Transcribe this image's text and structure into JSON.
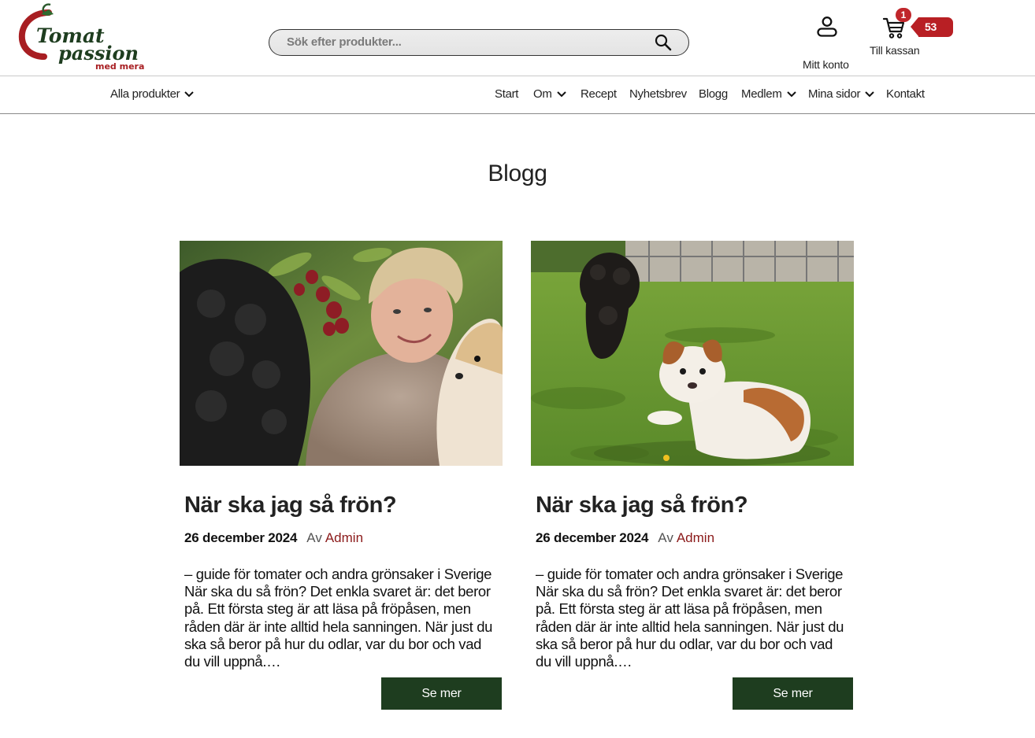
{
  "header": {
    "logo": {
      "line1": "Tomat",
      "line2": "passion",
      "tagline": "med mera"
    },
    "search": {
      "placeholder": "Sök efter produkter..."
    },
    "account_label": "Mitt konto",
    "cart": {
      "label": "Till kassan",
      "count": "1",
      "amount": "53 kr"
    }
  },
  "nav": {
    "all_products": "Alla produkter",
    "items": [
      "Start",
      "Om",
      "Recept",
      "Nyhetsbrev",
      "Blogg",
      "Medlem",
      "Mina sidor",
      "Kontakt"
    ]
  },
  "page": {
    "title": "Blogg"
  },
  "posts": [
    {
      "title": "När ska jag så frön?",
      "date": "26 december 2024",
      "by": "Av",
      "author": "Admin",
      "excerpt": "– guide för tomater och andra grönsaker i Sverige När ska du så frön?  Det enkla svaret är: det beror på. Ett första steg är att läsa på  fröpåsen, men råden där är inte alltid hela sanningen. När just du ska  så beror på hur du odlar, var du bor och vad du vill uppnå.…",
      "button": "Se mer"
    },
    {
      "title": "När ska jag så frön?",
      "date": "26 december 2024",
      "by": "Av",
      "author": "Admin",
      "excerpt": "– guide för tomater och andra grönsaker i Sverige När ska du så frön?  Det enkla svaret är: det beror på. Ett första steg är att läsa på  fröpåsen, men råden där är inte alltid hela sanningen. När just du ska  så beror på hur du odlar, var du bor och vad du vill uppnå.…",
      "button": "Se mer"
    }
  ],
  "colors": {
    "brand_red": "#b81f24",
    "brand_green": "#1e3d1f",
    "author_link": "#8b1a1a"
  }
}
